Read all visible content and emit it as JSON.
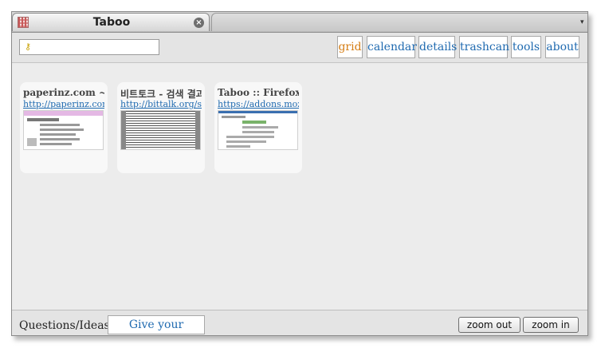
{
  "tab": {
    "title": "Taboo",
    "close_glyph": "×",
    "favicon": "taboo-grid-icon"
  },
  "toolbar": {
    "search": {
      "placeholder": "",
      "value": ""
    },
    "nav": [
      {
        "label": "grid",
        "active": true
      },
      {
        "label": "calendar",
        "active": false
      },
      {
        "label": "details",
        "active": false
      },
      {
        "label": "trashcan",
        "active": false
      },
      {
        "label": "tools",
        "active": false
      },
      {
        "label": "about",
        "active": false
      }
    ]
  },
  "cards": [
    {
      "title": "paperinz.com ~♡",
      "url": "http://paperinz.com/"
    },
    {
      "title": "비트토크 - 검색 결과",
      "url": "http://bittalk.org/search"
    },
    {
      "title": "Taboo :: Firefox Add-ons",
      "url": "https://addons.mozilla.org"
    }
  ],
  "footer": {
    "label": "Questions/Ideas?",
    "feedback": "Give your Feedback",
    "zoom_out": "zoom out",
    "zoom_in": "zoom in"
  },
  "colors": {
    "link": "#1f6ab0",
    "active_nav": "#d57d14",
    "background": "#ececec"
  }
}
